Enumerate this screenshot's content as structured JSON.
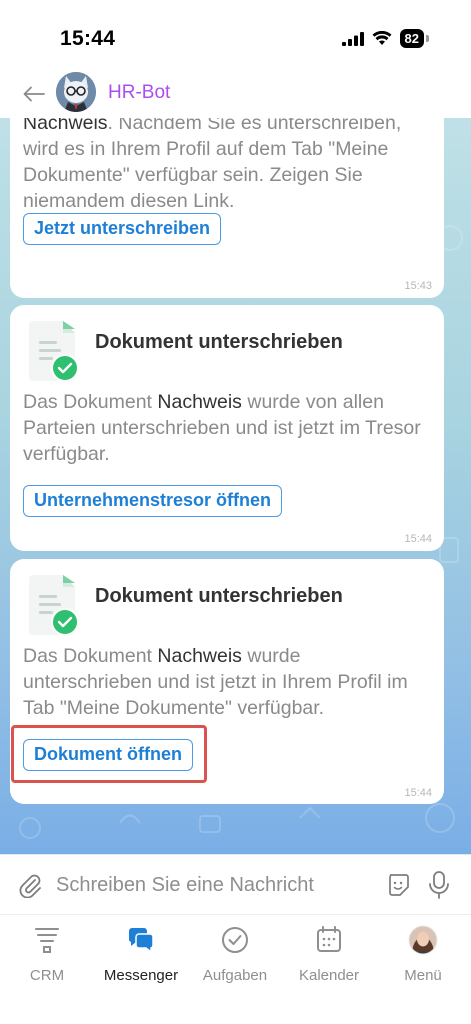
{
  "status": {
    "time": "15:44",
    "battery": "82"
  },
  "header": {
    "bot_name": "HR-Bot"
  },
  "messages": [
    {
      "text_bold": "Nachweis",
      "text_rest": ". Nachdem Sie es unterschreiben, wird es in Ihrem Profil auf dem Tab \"Meine Dokumente\" verfügbar sein. Zeigen Sie niemandem diesen Link.",
      "button": "Jetzt unterschreiben",
      "time": "15:43"
    },
    {
      "title": "Dokument unterschrieben",
      "text_pre": "Das Dokument ",
      "text_bold": "Nachweis",
      "text_rest": " wurde von allen Parteien unterschrieben und ist jetzt im Tresor verfügbar.",
      "button": "Unternehmenstresor öffnen",
      "time": "15:44"
    },
    {
      "title": "Dokument unterschrieben",
      "text_pre": "Das Dokument ",
      "text_bold": "Nachweis",
      "text_rest": " wurde unterschrieben und ist jetzt in Ihrem Profil im Tab \"Meine Dokumente\" verfügbar.",
      "button": "Dokument öffnen",
      "time": "15:44"
    }
  ],
  "input": {
    "placeholder": "Schreiben Sie eine Nachricht"
  },
  "tabs": [
    {
      "label": "CRM",
      "icon": "crm-icon",
      "active": false
    },
    {
      "label": "Messenger",
      "icon": "messenger-icon",
      "active": true
    },
    {
      "label": "Aufgaben",
      "icon": "tasks-check-icon",
      "active": false
    },
    {
      "label": "Kalender",
      "icon": "calendar-icon",
      "active": false
    },
    {
      "label": "Menü",
      "icon": "user-avatar-icon",
      "active": false
    }
  ],
  "colors": {
    "accent": "#1e7fd6",
    "bot_name": "#a94ef0",
    "highlight": "#d9534f",
    "check": "#2fbf71"
  }
}
